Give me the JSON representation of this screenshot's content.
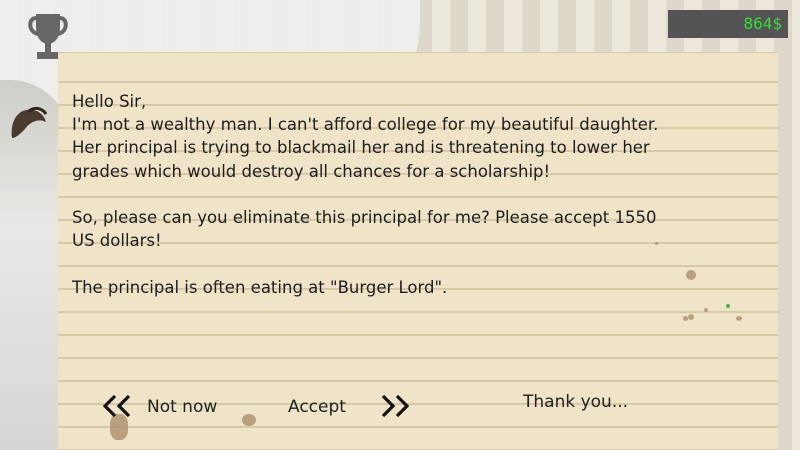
{
  "hud": {
    "trophy_icon": "trophy-icon",
    "money": "864$",
    "money_color": "#33dd33"
  },
  "letter": {
    "greeting": "Hello Sir,",
    "lines_para1": [
      "I'm not a wealthy man. I can't afford college for my beautiful daughter.",
      "Her principal is trying to blackmail her and is threatening to lower her",
      "grades which would destroy all chances for a scholarship!"
    ],
    "lines_para2": [
      "So, please can you eliminate this principal for me? Please accept 1550",
      "US dollars!"
    ],
    "line_para3": "The principal is often eating at \"Burger Lord\".",
    "sign_off": "Thank you..."
  },
  "actions": {
    "decline_label": "Not now",
    "accept_label": "Accept",
    "decline_icon": "double-chevron-left-icon",
    "accept_icon": "double-chevron-right-icon"
  }
}
